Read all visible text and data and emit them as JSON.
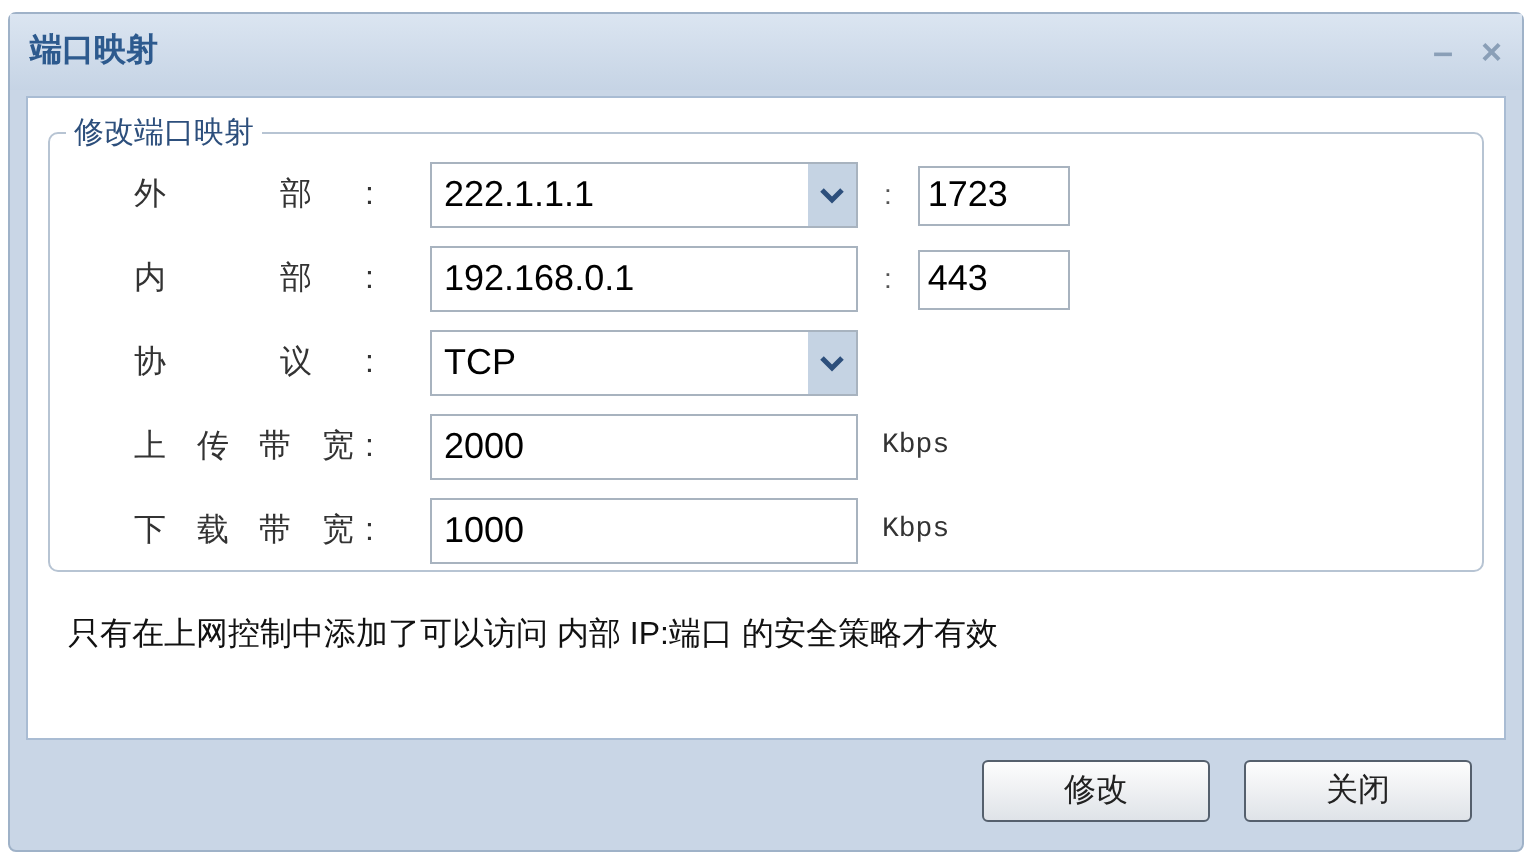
{
  "window": {
    "title": "端口映射",
    "controls": [
      "–",
      "×"
    ]
  },
  "group": {
    "title": "修改端口映射",
    "rows": [
      {
        "label": "外 部:",
        "kind": "select",
        "value": "222.1.1.1",
        "separator": ":",
        "port": "1723"
      },
      {
        "label": "内 部:",
        "kind": "text",
        "value": "192.168.0.1",
        "separator": ":",
        "port": "443"
      },
      {
        "label": "协 议:",
        "kind": "select",
        "value": "TCP"
      },
      {
        "label": "上 传 带 宽:",
        "kind": "text",
        "value": "2000",
        "unit": "Kbps"
      },
      {
        "label": "下 载 带 宽:",
        "kind": "text",
        "value": "1000",
        "unit": "Kbps"
      }
    ]
  },
  "note": "只有在上网控制中添加了可以访问 内部 IP:端口 的安全策略才有效",
  "buttons": [
    "修改",
    "关闭"
  ]
}
